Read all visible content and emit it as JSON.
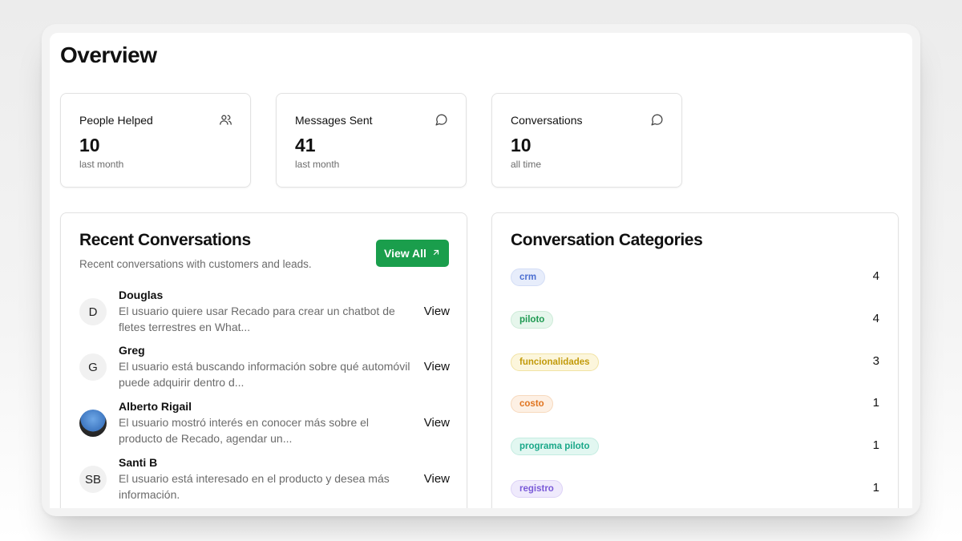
{
  "page": {
    "title": "Overview"
  },
  "stats": [
    {
      "label": "People Helped",
      "value": "10",
      "period": "last month",
      "icon": "users-icon"
    },
    {
      "label": "Messages Sent",
      "value": "41",
      "period": "last month",
      "icon": "message-circle-icon"
    },
    {
      "label": "Conversations",
      "value": "10",
      "period": "all time",
      "icon": "message-circle-icon"
    }
  ],
  "recent": {
    "title": "Recent Conversations",
    "description": "Recent conversations with customers and leads.",
    "view_all_label": "View All",
    "items": [
      {
        "initials": "D",
        "name": "Douglas",
        "message": "El usuario quiere usar Recado para crear un chatbot de fletes terrestres en What...",
        "action": "View"
      },
      {
        "initials": "G",
        "name": "Greg",
        "message": "El usuario está buscando información sobre qué automóvil puede adquirir dentro d...",
        "action": "View"
      },
      {
        "initials": "",
        "name": "Alberto Rigail",
        "message": "El usuario mostró interés en conocer más sobre el producto de Recado, agendar un...",
        "action": "View"
      },
      {
        "initials": "SB",
        "name": "Santi B",
        "message": "El usuario está interesado en el producto y desea más información.",
        "action": "View"
      }
    ]
  },
  "categories": {
    "title": "Conversation Categories",
    "items": [
      {
        "label": "crm",
        "count": "4",
        "color": "#4c6fd1",
        "bg": "#e7edfb",
        "border": "#d3ddf6"
      },
      {
        "label": "piloto",
        "count": "4",
        "color": "#1f9a52",
        "bg": "#e6f6ec",
        "border": "#cdebd8"
      },
      {
        "label": "funcionalidades",
        "count": "3",
        "color": "#c29a0a",
        "bg": "#fcf6dc",
        "border": "#f1e3a4"
      },
      {
        "label": "costo",
        "count": "1",
        "color": "#e0741f",
        "bg": "#fdf0e4",
        "border": "#f7d9bd"
      },
      {
        "label": "programa piloto",
        "count": "1",
        "color": "#1aa889",
        "bg": "#e2f7f1",
        "border": "#c4ece1"
      },
      {
        "label": "registro",
        "count": "1",
        "color": "#7a5ad8",
        "bg": "#efeafc",
        "border": "#ddd2f7"
      }
    ]
  }
}
